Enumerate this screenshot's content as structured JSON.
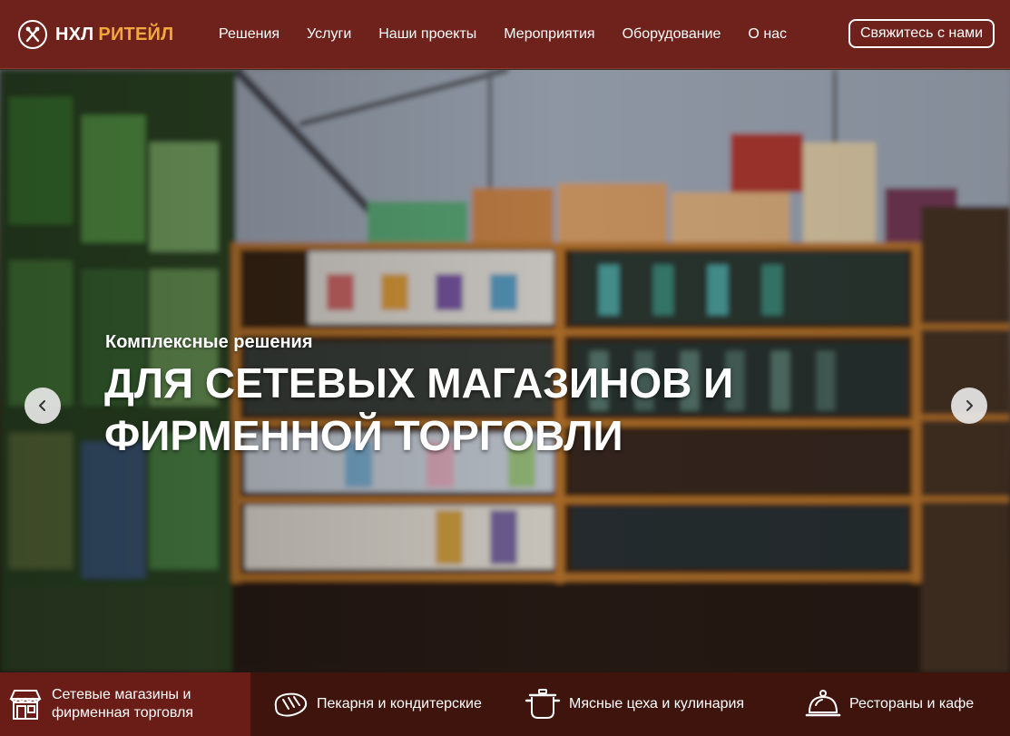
{
  "brand": {
    "word1": "НХЛ",
    "word2": "РИТЕЙЛ",
    "accent_color": "#f2a83a",
    "header_color": "#6e221b"
  },
  "nav": {
    "items": [
      {
        "label": "Решения"
      },
      {
        "label": "Услуги"
      },
      {
        "label": "Наши проекты"
      },
      {
        "label": "Мероприятия"
      },
      {
        "label": "Оборудование"
      },
      {
        "label": "О нас"
      }
    ],
    "contact_label": "Свяжитесь с нами"
  },
  "hero": {
    "subtitle": "Комплексные решения",
    "title_line1": "ДЛЯ СЕТЕВЫХ МАГАЗИНОВ И",
    "title_line2": "ФИРМЕННОЙ ТОРГОВЛИ",
    "prev_icon": "chevron-left-icon",
    "next_icon": "chevron-right-icon"
  },
  "categories": [
    {
      "line1": "Сетевые магазины и",
      "line2": "фирменная торговля",
      "icon": "storefront-icon",
      "active": true
    },
    {
      "line1": "Пекарня и кондитерские",
      "line2": "",
      "icon": "bread-icon",
      "active": false
    },
    {
      "line1": "Мясные цеха и кулинария",
      "line2": "",
      "icon": "pot-icon",
      "active": false
    },
    {
      "line1": "Рестораны и кафе",
      "line2": "",
      "icon": "cloche-icon",
      "active": false
    }
  ]
}
